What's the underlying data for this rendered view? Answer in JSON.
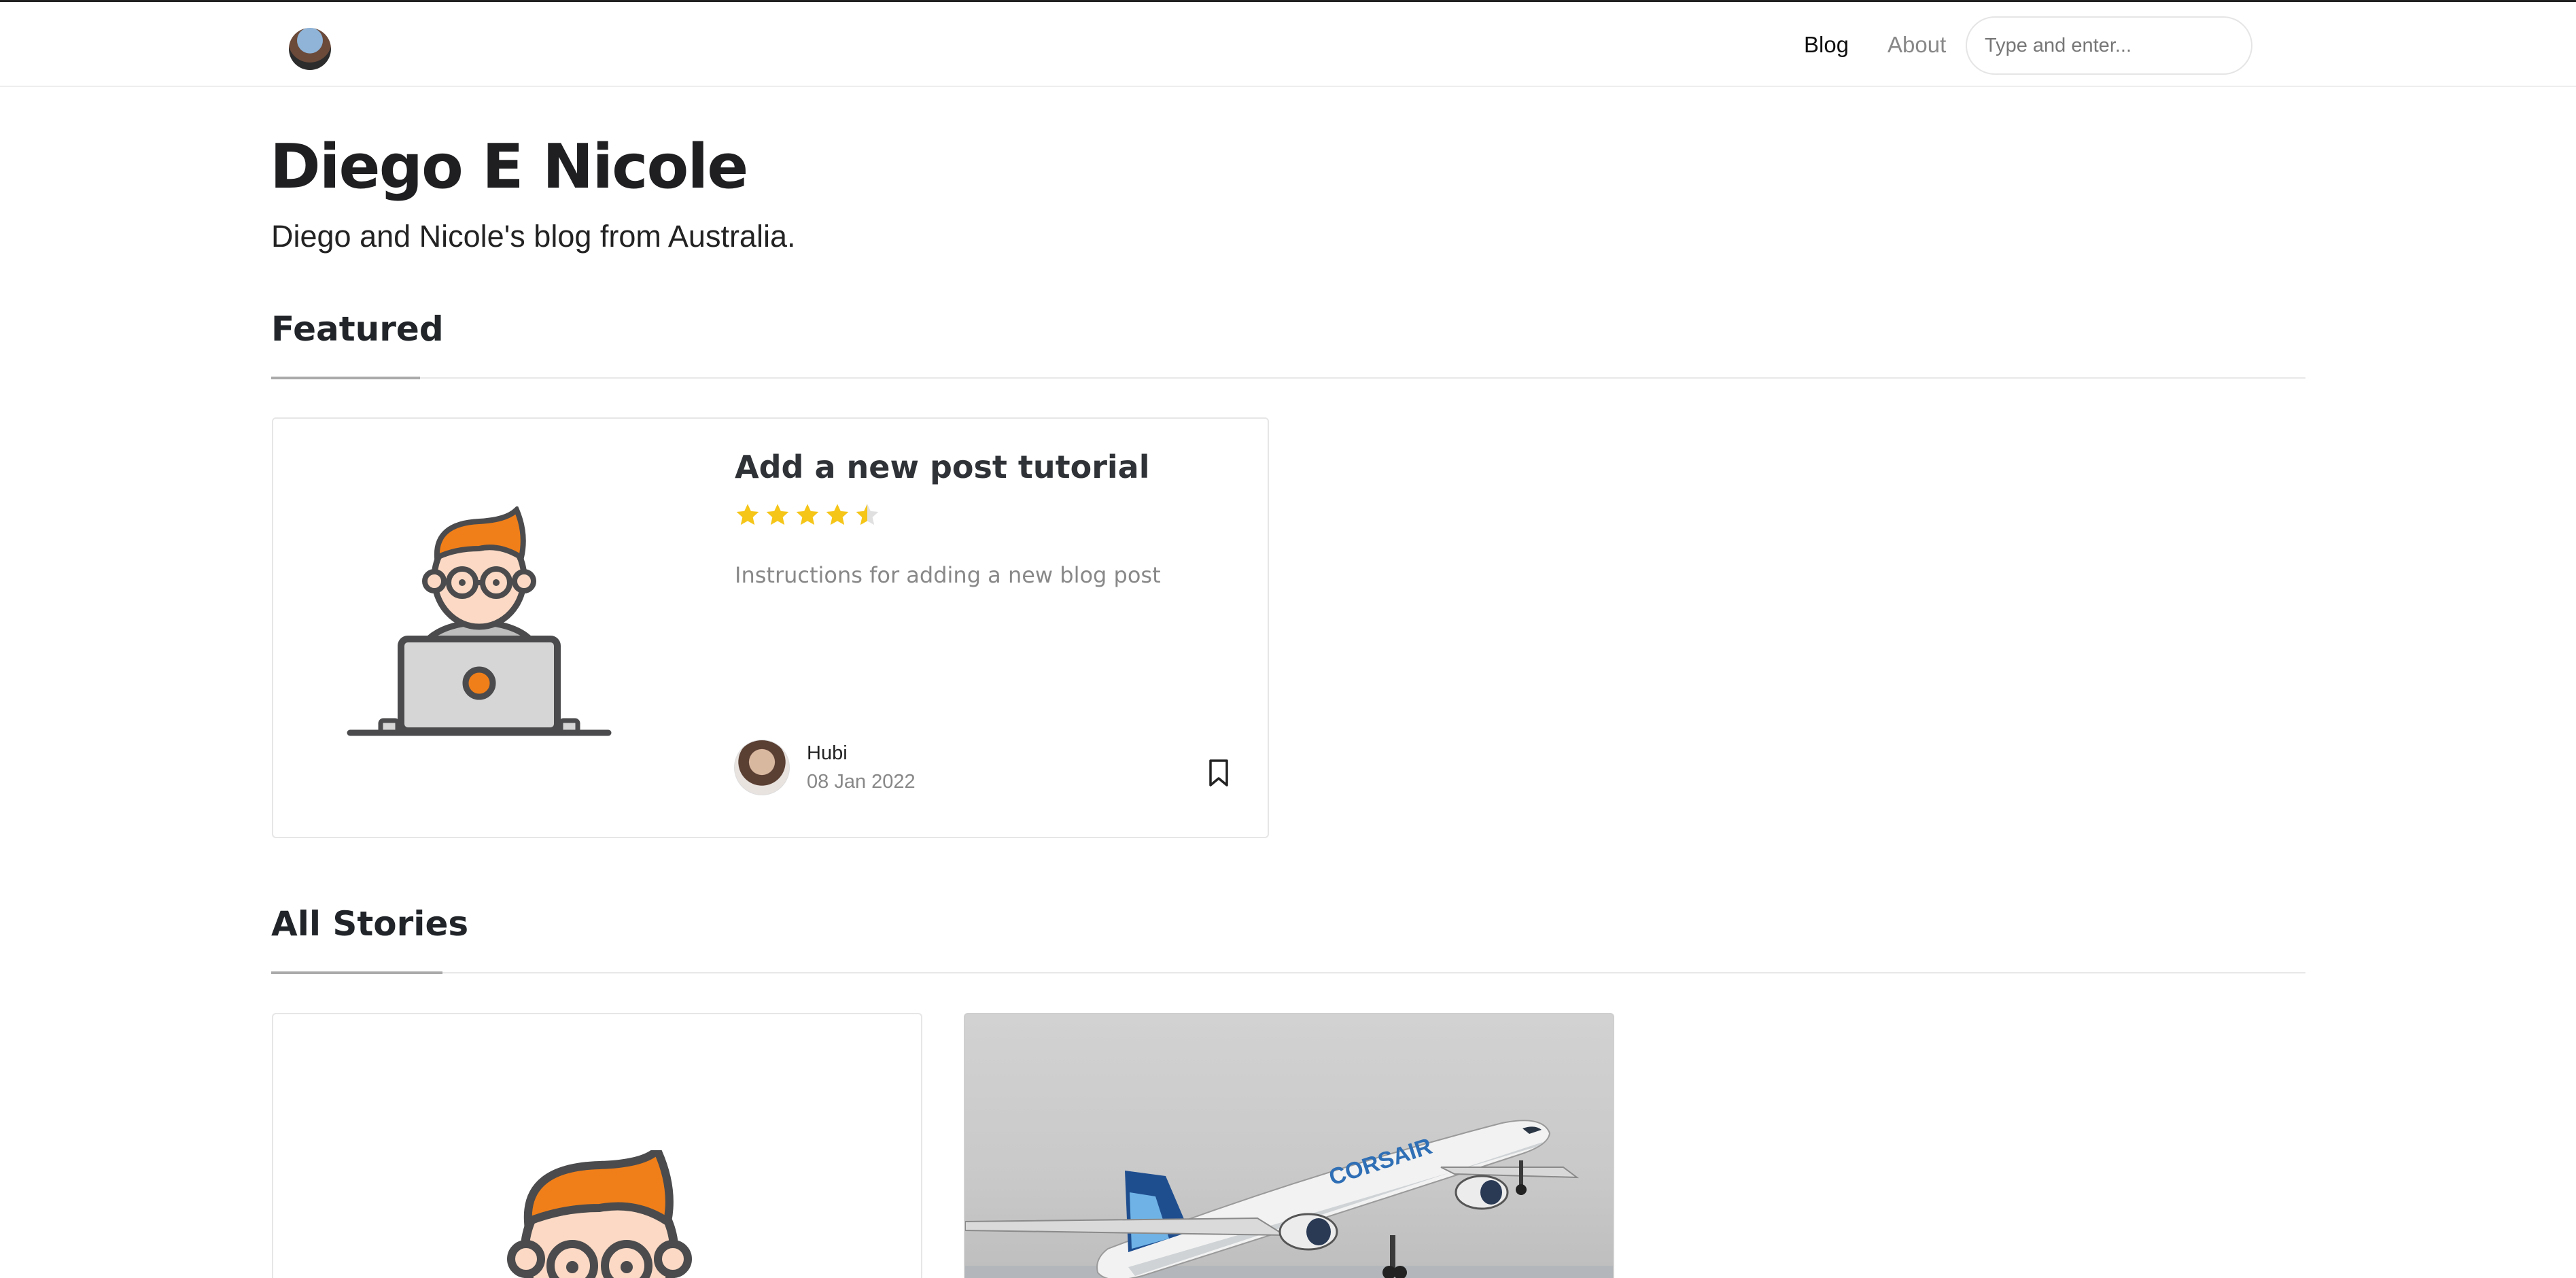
{
  "nav": {
    "blog_label": "Blog",
    "about_label": "About",
    "search_placeholder": "Type and enter..."
  },
  "hero": {
    "title": "Diego E Nicole",
    "description": "Diego and Nicole's blog from Australia."
  },
  "featured": {
    "heading": "Featured",
    "post": {
      "title": "Add a new post tutorial",
      "rating": 4.5,
      "rating_max": 5,
      "excerpt": "Instructions for adding a new blog post",
      "author": "Hubi",
      "date": "08 Jan 2022",
      "image_icon": "developer-laptop-illustration"
    }
  },
  "stories": {
    "heading": "All Stories",
    "items": [
      {
        "image_icon": "developer-laptop-illustration"
      },
      {
        "image_icon": "airplane-photo",
        "livery_text": "CORSAIR"
      }
    ]
  },
  "colors": {
    "star": "#f5c518",
    "accent_orange": "#f07f19",
    "muted_text": "#888888"
  }
}
